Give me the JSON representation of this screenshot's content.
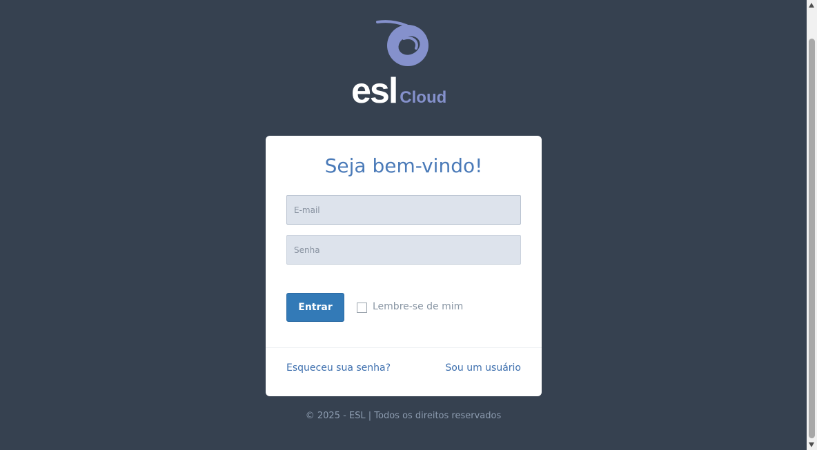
{
  "logo": {
    "primary": "esl",
    "secondary": "Cloud",
    "icon": "swirl-logo-icon"
  },
  "login": {
    "title": "Seja bem-vindo!",
    "email_placeholder": "E-mail",
    "password_placeholder": "Senha",
    "submit_label": "Entrar",
    "remember_label": "Lembre-se de mim",
    "remember_checked": false,
    "forgot_link": "Esqueceu sua senha?",
    "user_link": "Sou um usuário"
  },
  "footer": {
    "text": "© 2025 - ESL | Todos os direitos reservados"
  },
  "colors": {
    "background": "#364150",
    "accent": "#337ab7",
    "title": "#4a7ab8",
    "logo_secondary": "#8591cc"
  }
}
